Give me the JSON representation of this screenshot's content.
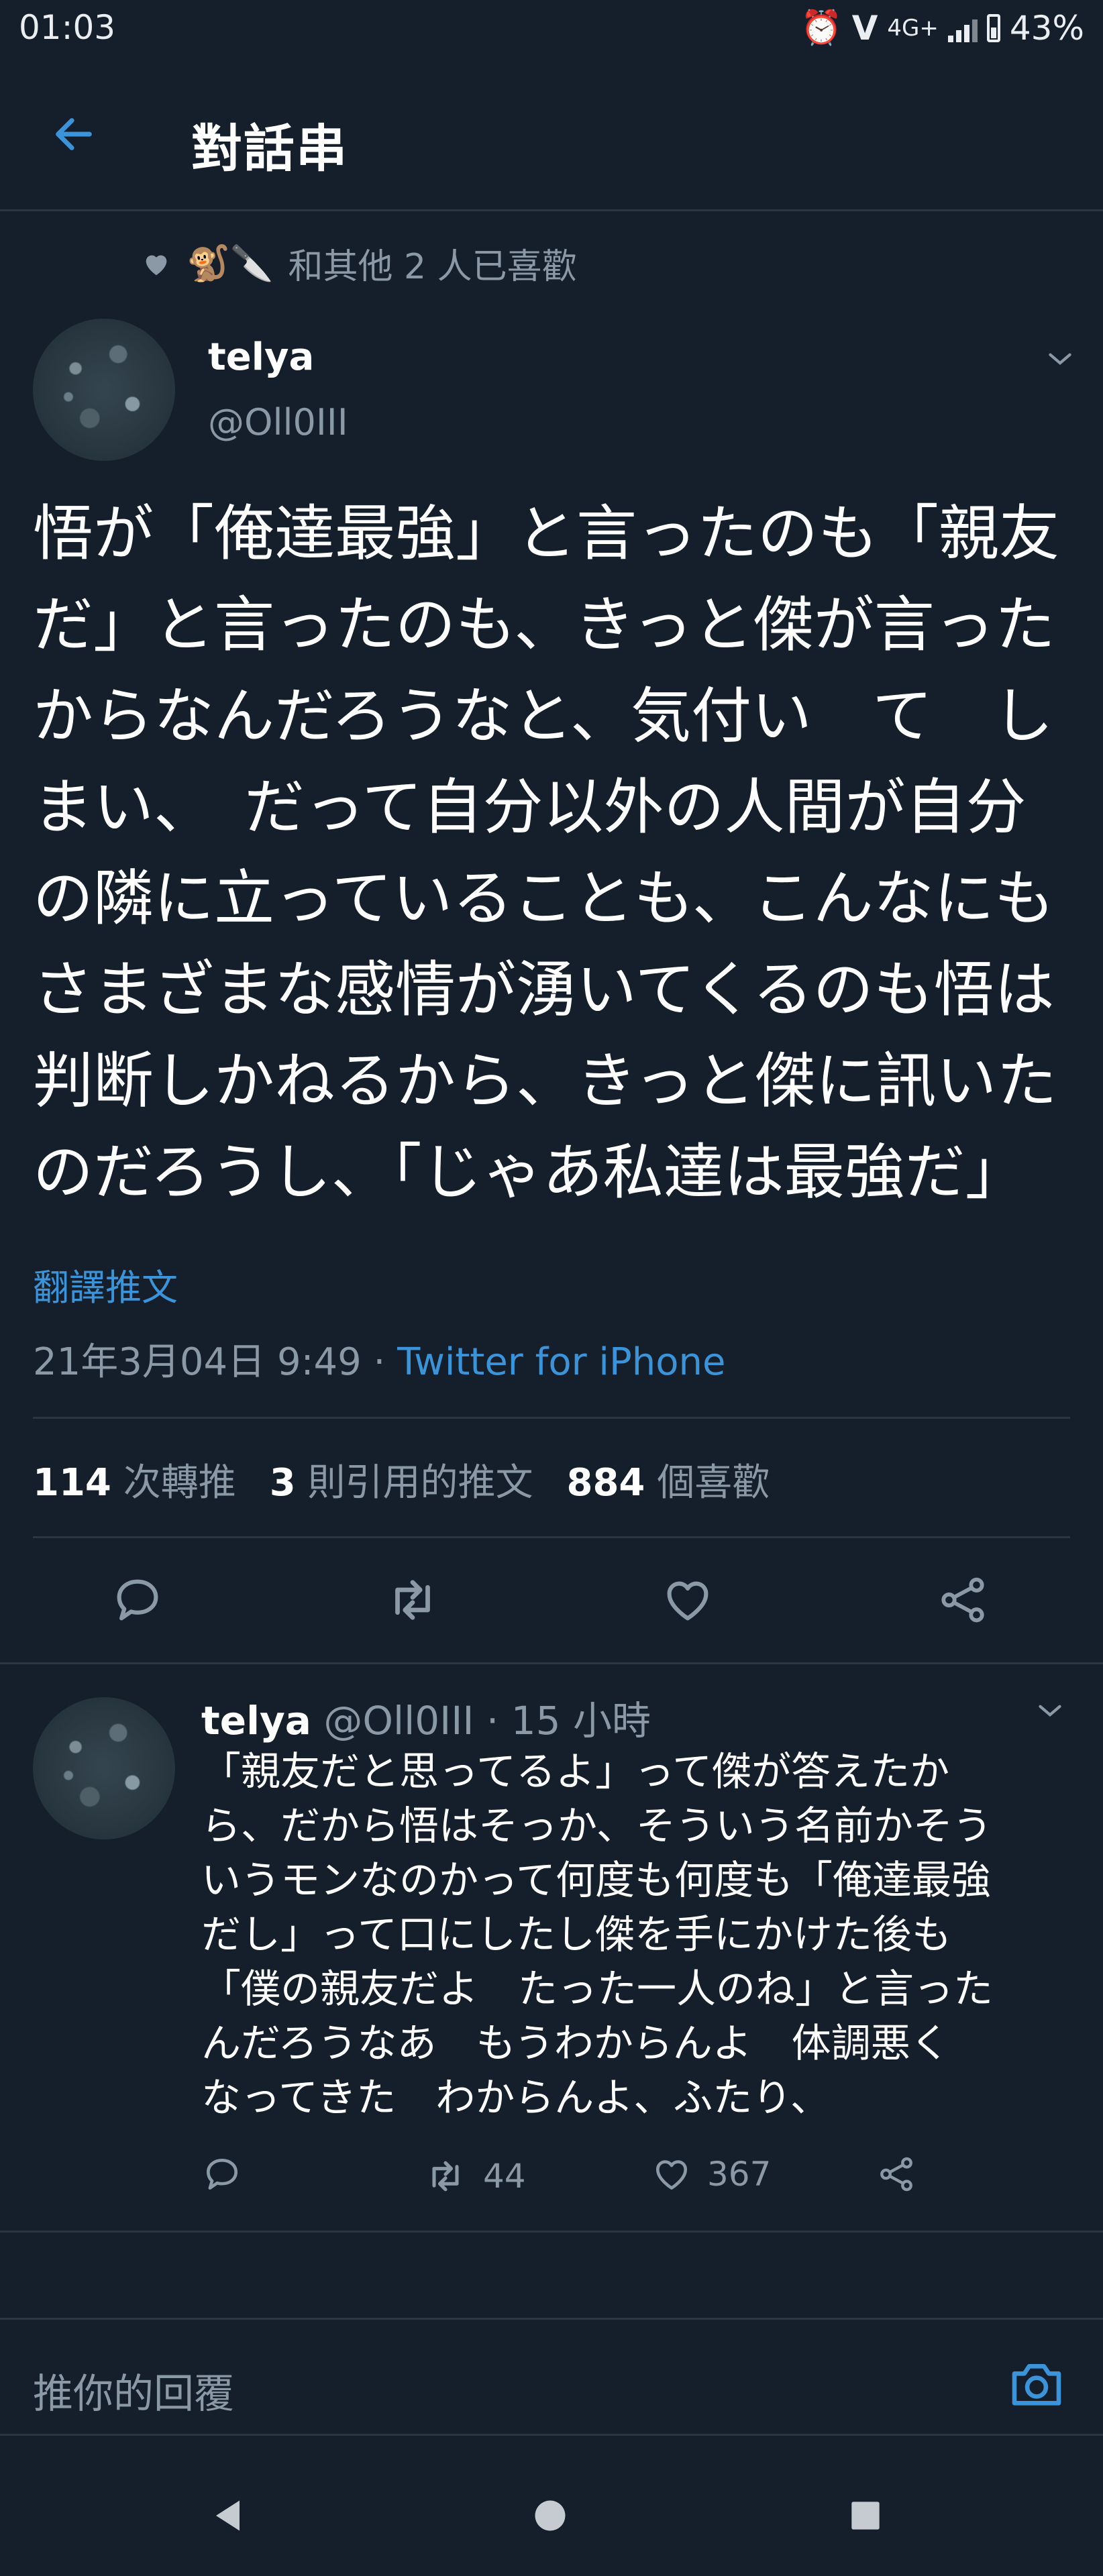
{
  "status_bar": {
    "time": "01:03",
    "network": "4G+",
    "volte": "VoLTE",
    "battery": "43%"
  },
  "header": {
    "back_icon": "arrow-left-icon",
    "title": "對話串"
  },
  "tweet": {
    "liked_by": "和其他 2 人已喜歡",
    "liked_emoji": "🐒🔪",
    "author_name": "telya",
    "author_handle": "@Oll0III",
    "body": "悟が「俺達最強」と言ったのも「親友\nだ」と言ったのも、きっと傑が言った\nからなんだろうなと、気付い　て　し\nまい、　だって自分以外の人間が自分\nの隣に立っていることも、こんなにも\nさまざまな感情が湧いてくるのも悟は\n判断しかねるから、きっと傑に訊いた\nのだろうし、「じゃあ私達は最強だ」",
    "translate_label": "翻譯推文",
    "timestamp": "21年3月04日 9:49 ·",
    "source": "Twitter for iPhone",
    "stats": {
      "retweets_count": "114",
      "retweets_label": "次轉推",
      "quotes_count": "3",
      "quotes_label": "則引用的推文",
      "likes_count": "884",
      "likes_label": "個喜歡"
    }
  },
  "reply": {
    "author_name": "telya",
    "author_handle": "@Oll0III",
    "time": "· 15 小時",
    "body": "「親友だと思ってるよ」って傑が答えたか\nら、だから悟はそっか、そういう名前かそう\nいうモンなのかって何度も何度も「俺達最強\nだし」って口にしたし傑を手にかけた後も\n「僕の親友だよ　たった一人のね」と言った\nんだろうなあ　もうわからんよ　体調悪く\nなってきた　わからんよ、ふたり、",
    "retweets": "44",
    "likes": "367"
  },
  "compose": {
    "placeholder": "推你的回覆"
  },
  "colors": {
    "background": "#151f2b",
    "accent": "#3b94d9",
    "muted": "#8b98a5"
  }
}
